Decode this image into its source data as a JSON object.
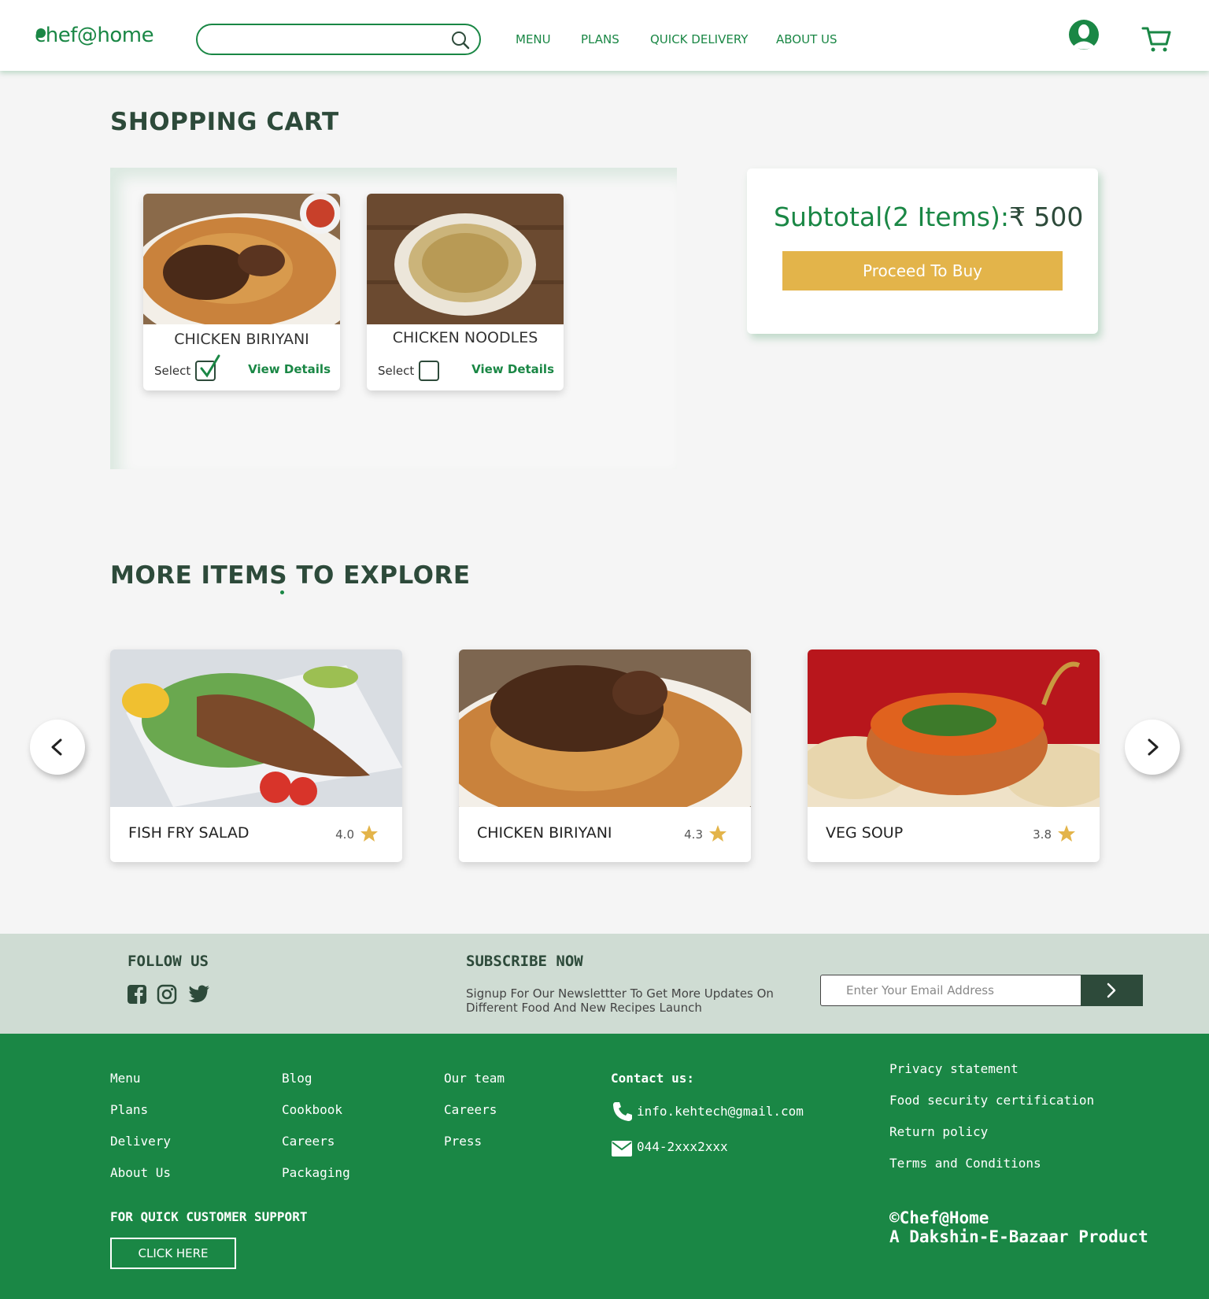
{
  "header": {
    "logo": "chef@home",
    "search": {
      "value": "",
      "placeholder": ""
    },
    "nav": [
      "MENU",
      "PLANS",
      "QUICK DELIVERY",
      "ABOUT US"
    ]
  },
  "cart": {
    "title": "SHOPPING CART",
    "items": [
      {
        "name": "CHICKEN BIRIYANI",
        "select_label": "Select",
        "details_label": "View Details",
        "selected": true
      },
      {
        "name": "CHICKEN NOODLES",
        "select_label": "Select",
        "details_label": "View Details",
        "selected": false
      }
    ],
    "subtotal_label": "Subtotal(2 Items):",
    "subtotal_amount": "₹ 500",
    "buy_label": "Proceed To Buy"
  },
  "explore": {
    "title": "MORE ITEMS TO EXPLORE",
    "items": [
      {
        "name": "FISH FRY SALAD",
        "rating": "4.0"
      },
      {
        "name": "CHICKEN BIRIYANI",
        "rating": "4.3"
      },
      {
        "name": "VEG SOUP",
        "rating": "3.8"
      }
    ]
  },
  "subscribe": {
    "follow_title": "FOLLOW US",
    "social_icons": [
      "facebook-icon",
      "instagram-icon",
      "twitter-icon"
    ],
    "title": "SUBSCRIBE NOW",
    "description": "Signup For Our Newslettter To Get More Updates On Different Food And New Recipes Launch",
    "email_placeholder": "Enter Your Email Address"
  },
  "footer": {
    "col1": [
      "Menu",
      "Plans",
      "Delivery",
      "About Us"
    ],
    "col2": [
      "Blog",
      "Cookbook",
      "Careers",
      "Packaging"
    ],
    "col3": [
      "Our team",
      "Careers",
      "Press"
    ],
    "contact_title": "Contact us:",
    "email": "info.kehtech@gmail.com",
    "phone": "044-2xxx2xxx",
    "policies": [
      "Privacy statement",
      "Food security certification",
      "Return policy",
      "Terms and Conditions"
    ],
    "support_title": "FOR QUICK CUSTOMER SUPPORT",
    "support_button": "CLICK HERE",
    "copyright": "©Chef@Home",
    "tagline": "A Dakshin-E-Bazaar Product"
  },
  "colors": {
    "brand_green": "#1a8745",
    "dark_green": "#2d4a3a",
    "accent_gold": "#e3b44a",
    "strip_bg": "#cfdcd3"
  }
}
